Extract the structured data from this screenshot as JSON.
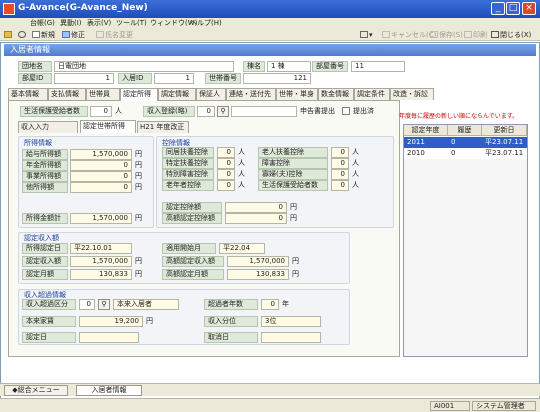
{
  "window": {
    "title": "G-Avance(G-Avance_New)"
  },
  "menu": [
    "台帳(G)",
    "異動(I)",
    "表示(V)",
    "ツール(T)",
    "ウィンドウ(W)",
    "ヘルプ(H)"
  ],
  "toolbar": {
    "new": "新規",
    "edit": "修正",
    "name_change": "氏名変更",
    "cancel": "キャンセル(C)",
    "save": "保存(S)",
    "print": "印刷",
    "close": "閉じる(X)"
  },
  "section_title": "入居者情報",
  "resident": {
    "complex_label": "団地名",
    "complex_value": "日電団地",
    "building_label": "棟名",
    "building_value": "1 棟",
    "room_label": "部屋番号",
    "room_value": "11",
    "room_id_label": "部屋ID",
    "room_id_value": "1",
    "resident_id_label": "入居ID",
    "resident_id_value": "1",
    "household_label": "世帯番号",
    "household_value": "121"
  },
  "tabs": [
    "基本情報",
    "支払情報",
    "世帯員",
    "認定所得",
    "調定情報",
    "保証人",
    "連絡・送付先",
    "世帯・単身",
    "数金情報",
    "調定条件",
    "改造・訴訟"
  ],
  "welfare": {
    "recipients_label": "生活保護受給者数",
    "recipients_value": "0",
    "recipients_unit": "人",
    "income_reg_label": "収入登録(略)",
    "income_reg_value": "0",
    "report_label": "申告書提出",
    "report_submitted": "提出済"
  },
  "subtabs": [
    "収入入力",
    "認定世帯所得",
    "H21 年度改正"
  ],
  "income": {
    "title": "所得情報",
    "rows": [
      {
        "label": "給与所得額",
        "value": "1,570,000"
      },
      {
        "label": "年金所得額",
        "value": "0"
      },
      {
        "label": "事業所得額",
        "value": "0"
      },
      {
        "label": "他所得額",
        "value": "0"
      }
    ],
    "unit": "円",
    "total_label": "所得金額計",
    "total_value": "1,570,000"
  },
  "deduction": {
    "title": "控除情報",
    "left": [
      {
        "label": "同居扶養控除",
        "value": "0"
      },
      {
        "label": "特定扶養控除",
        "value": "0"
      },
      {
        "label": "特別障害控除",
        "value": "0"
      },
      {
        "label": "老年者控除",
        "value": "0"
      }
    ],
    "right": [
      {
        "label": "老人扶養控除",
        "value": "0"
      },
      {
        "label": "障害控除",
        "value": "0"
      },
      {
        "label": "寡婦(夫)控除",
        "value": "0"
      },
      {
        "label": "生活保護受給者数",
        "value": "0"
      }
    ],
    "unit": "人",
    "sum_label": "認定控除額",
    "sum_value": "0",
    "high_sum_label": "高額認定控除額",
    "high_sum_value": "0",
    "yen": "円"
  },
  "recognized": {
    "title": "認定収入額",
    "date_label": "所得認定日",
    "date_value": "平22.10.01",
    "apply_label": "適用開始月",
    "apply_value": "平22.04",
    "income_label": "認定収入額",
    "income_value": "1,570,000",
    "high_income_label": "高額認定収入額",
    "high_income_value": "1,570,000",
    "monthly_label": "認定月額",
    "monthly_value": "130,833",
    "high_monthly_label": "高額認定月額",
    "high_monthly_value": "130,833",
    "yen": "円"
  },
  "excess": {
    "title": "収入超過情報",
    "category_label": "収入超過区分",
    "category_code": "0",
    "category_value": "本来入居者",
    "years_label": "超過者年数",
    "years_value": "0",
    "years_unit": "年",
    "rent_label": "本来家賃",
    "rent_value": "19,200",
    "rent_unit": "円",
    "rank_label": "収入分位",
    "rank_value": "3位",
    "cert_date_label": "認定日",
    "cert_date_value": "",
    "cancel_date_label": "取消日",
    "cancel_date_value": ""
  },
  "history": {
    "notice": "年度毎に履歴の新しい順にならんでいます。",
    "columns": [
      "認定年度",
      "履歴",
      "更新日"
    ],
    "rows": [
      {
        "year": "2011",
        "hist": "0",
        "date": "平23.07.11"
      },
      {
        "year": "2010",
        "hist": "0",
        "date": "平23.07.11"
      }
    ]
  },
  "bottom_tabs": [
    "◆総合メニュー",
    "入居者情報"
  ],
  "status": {
    "code": "AI001",
    "user": "システム管理者"
  },
  "colors": {
    "title_blue": "#1f4db8",
    "section_blue": "#4f7cd0",
    "selected_row": "#2f5fc4",
    "notice_red": "#cc0000"
  }
}
